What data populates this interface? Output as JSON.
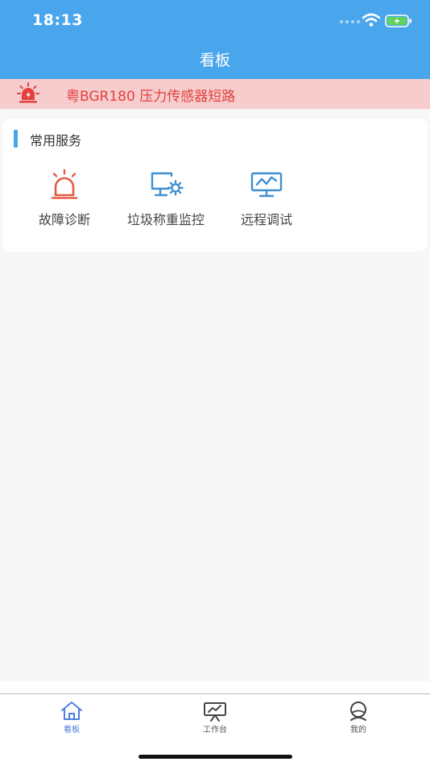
{
  "status_bar": {
    "time": "18:13"
  },
  "nav": {
    "title": "看板"
  },
  "alert": {
    "icon": "alarm-siren-icon",
    "text": "粤BGR180 压力传感器短路"
  },
  "services": {
    "title": "常用服务",
    "items": [
      {
        "icon": "alarm-siren-icon",
        "label": "故障诊断"
      },
      {
        "icon": "monitor-gear-icon",
        "label": "垃圾称重监控"
      },
      {
        "icon": "monitor-chart-icon",
        "label": "远程调试"
      }
    ]
  },
  "tabbar": {
    "items": [
      {
        "icon": "home-icon",
        "label": "看板",
        "active": true
      },
      {
        "icon": "presentation-chart-icon",
        "label": "工作台",
        "active": false
      },
      {
        "icon": "profile-icon",
        "label": "我的",
        "active": false
      }
    ]
  },
  "colors": {
    "header": "#4aa6ec",
    "alert_bg": "#f6cccd",
    "alert_text": "#e2413f",
    "icon_blue": "#3e8fd2",
    "tab_active": "#4e7ee0"
  }
}
